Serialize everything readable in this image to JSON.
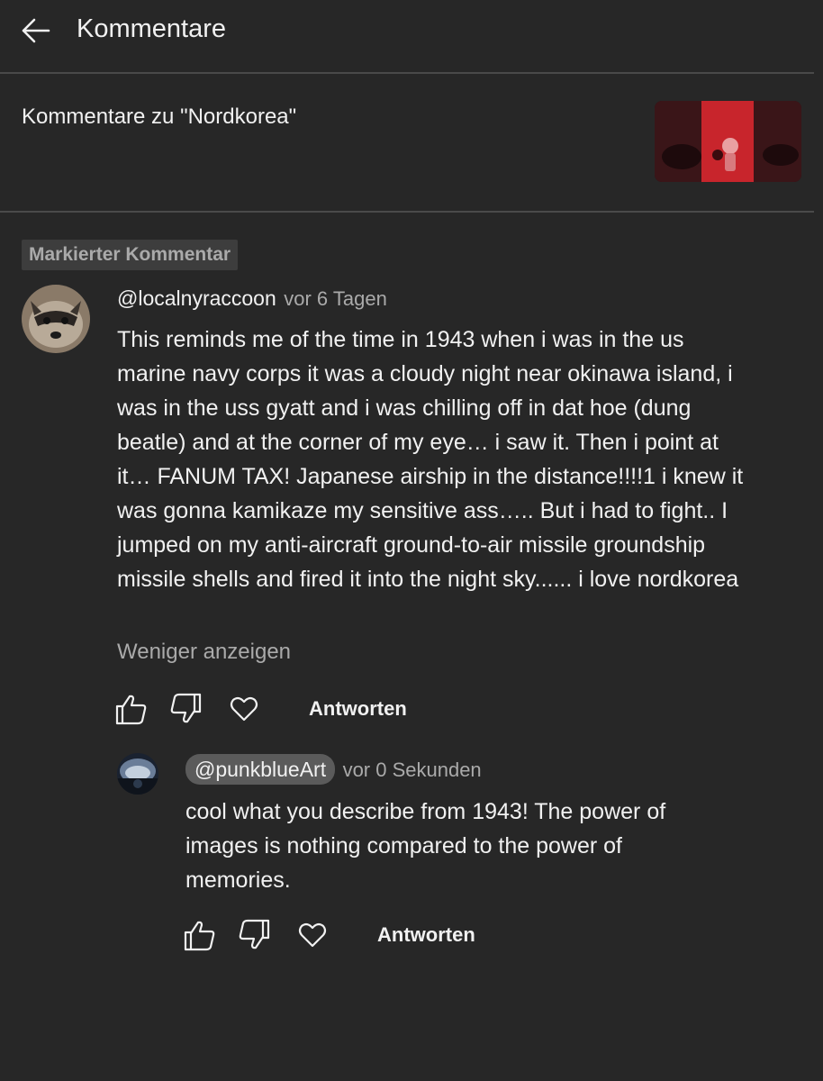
{
  "header": {
    "title": "Kommentare",
    "back_icon": "arrow-left-icon"
  },
  "video": {
    "title": "Kommentare zu \"Nordkorea\""
  },
  "pinned": {
    "badge": "Markierter Kommentar",
    "author": "@localnyraccoon",
    "time": "vor 6 Tagen",
    "text": "This reminds me of the time in 1943 when i was in the us marine navy corps it was a cloudy night near okinawa island, i was in the uss gyatt and i was chilling off in dat hoe (dung beatle) and at the corner of my eye… i saw it. Then i point at it… FANUM TAX! Japanese airship in the distance!!!!1 i knew it was gonna kamikaze my sensitive ass….. But i had to fight.. I jumped on my anti-aircraft ground-to-air missile groundship missile shells and fired it into the night sky...... i love nordkorea",
    "show_less": "Weniger anzeigen",
    "reply_label": "Antworten"
  },
  "reply": {
    "author": "@punkblueArt",
    "time": "vor 0 Sekunden",
    "text": "cool what you describe from 1943! The power of images is nothing compared to the power of memories.",
    "reply_label": "Antworten"
  },
  "icons": {
    "like": "thumbs-up-icon",
    "dislike": "thumbs-down-icon",
    "heart": "heart-icon"
  }
}
